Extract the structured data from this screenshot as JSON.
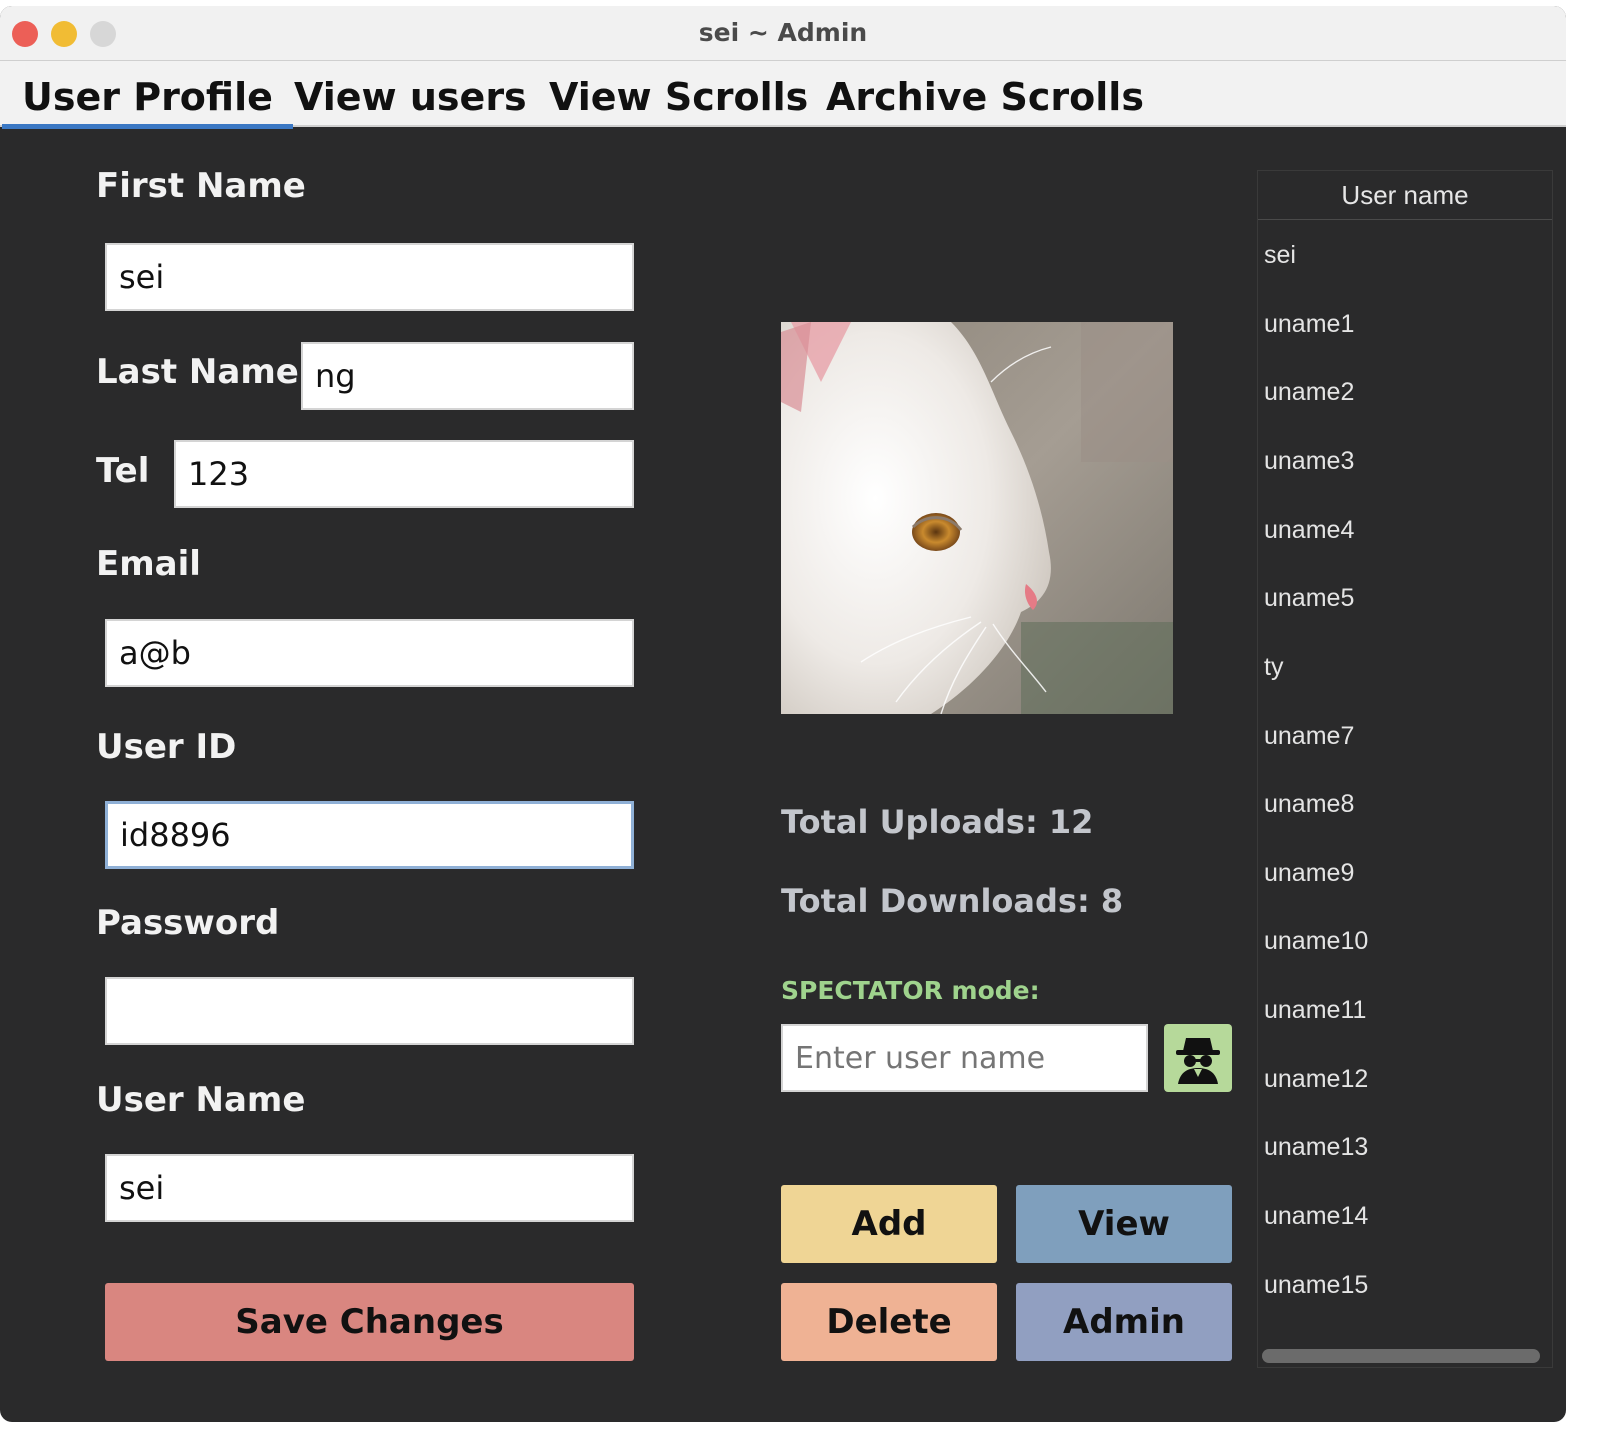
{
  "window": {
    "title": "sei ~ Admin"
  },
  "tabs": [
    {
      "label": "User Profile"
    },
    {
      "label": "View users"
    },
    {
      "label": "View Scrolls"
    },
    {
      "label": "Archive Scrolls"
    }
  ],
  "form": {
    "first_name_label": "First Name",
    "first_name_value": "sei",
    "last_name_label": "Last Name",
    "last_name_value": "ng",
    "tel_label": "Tel",
    "tel_value": "123",
    "email_label": "Email",
    "email_value": "a@b",
    "user_id_label": "User ID",
    "user_id_value": "id8896",
    "password_label": "Password",
    "password_value": "",
    "user_name_label": "User Name",
    "user_name_value": "sei",
    "save_label": "Save Changes"
  },
  "stats": {
    "uploads": "Total Uploads: 12",
    "downloads": "Total Downloads: 8"
  },
  "spectator": {
    "label": "SPECTATOR mode:",
    "placeholder": "Enter user name",
    "icon": "spy-icon"
  },
  "actions": {
    "add": "Add",
    "view": "View",
    "delete": "Delete",
    "admin": "Admin"
  },
  "user_list": {
    "header": "User name",
    "items": [
      "sei",
      "uname1",
      "uname2",
      "uname3",
      "uname4",
      "uname5",
      "ty",
      "uname7",
      "uname8",
      "uname9",
      "uname10",
      "uname11",
      "uname12",
      "uname13",
      "uname14",
      "uname15"
    ]
  },
  "colors": {
    "background": "#2a2a2b",
    "save_button": "#d98680",
    "add_button": "#efd595",
    "view_button": "#7f9fbd",
    "delete_button": "#efb294",
    "admin_button": "#919fc1",
    "spectator_text": "#9fd38d",
    "spectator_icon_bg": "#b6d99a",
    "active_tab_underline": "#3b78c4"
  }
}
